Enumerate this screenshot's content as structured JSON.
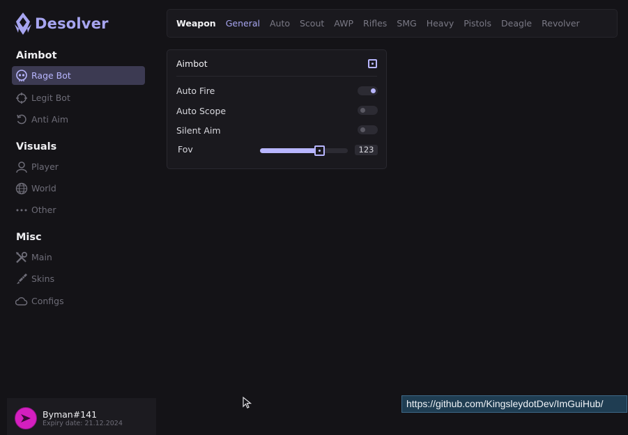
{
  "brand": {
    "name": "Desolver",
    "accent": "#a7a5f0"
  },
  "sidebar": {
    "sections": [
      {
        "title": "Aimbot",
        "items": [
          {
            "label": "Rage Bot",
            "icon": "skull-icon",
            "active": true
          },
          {
            "label": "Legit Bot",
            "icon": "crosshair-icon",
            "active": false
          },
          {
            "label": "Anti Aim",
            "icon": "rotate-icon",
            "active": false
          }
        ]
      },
      {
        "title": "Visuals",
        "items": [
          {
            "label": "Player",
            "icon": "person-icon",
            "active": false
          },
          {
            "label": "World",
            "icon": "globe-icon",
            "active": false
          },
          {
            "label": "Other",
            "icon": "dots-icon",
            "active": false
          }
        ]
      },
      {
        "title": "Misc",
        "items": [
          {
            "label": "Main",
            "icon": "tools-icon",
            "active": false
          },
          {
            "label": "Skins",
            "icon": "brush-icon",
            "active": false
          },
          {
            "label": "Configs",
            "icon": "cloud-icon",
            "active": false
          }
        ]
      }
    ]
  },
  "user": {
    "name": "Byman#141",
    "expiry": "Expiry date: 21.12.2024",
    "avatar_color": "#d41fbf"
  },
  "tabs": {
    "heading": "Weapon",
    "items": [
      "General",
      "Auto",
      "Scout",
      "AWP",
      "Rifles",
      "SMG",
      "Heavy",
      "Pistols",
      "Deagle",
      "Revolver"
    ],
    "active": "General"
  },
  "aimbot_panel": {
    "title": "Aimbot",
    "toggles": [
      {
        "label": "Auto Fire",
        "on": true
      },
      {
        "label": "Auto Scope",
        "on": false
      },
      {
        "label": "Silent Aim",
        "on": false
      }
    ],
    "fov": {
      "label": "Fov",
      "value": "123",
      "fraction": 0.675
    }
  },
  "url_tooltip": "https://github.com/KingsleydotDev/ImGuiHub/"
}
